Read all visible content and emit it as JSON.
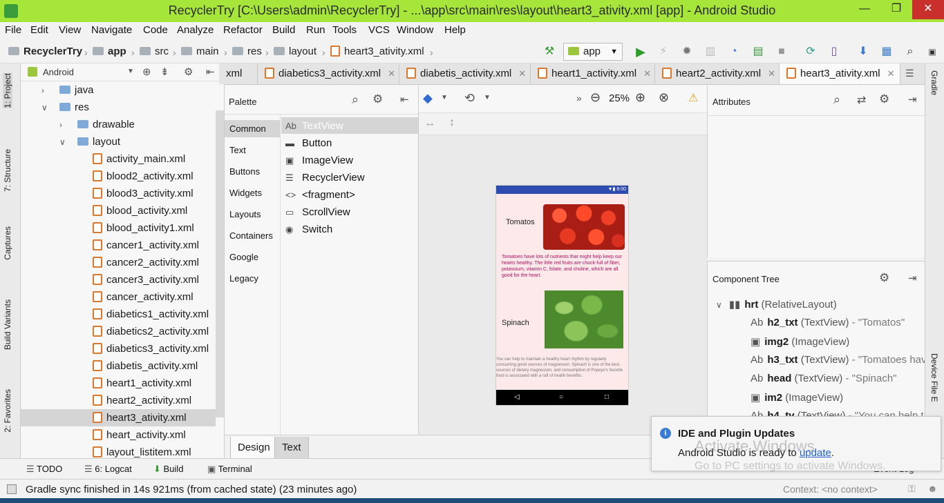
{
  "window": {
    "title": "RecyclerTry [C:\\Users\\admin\\RecyclerTry] - ...\\app\\src\\main\\res\\layout\\heart3_ativity.xml [app] - Android Studio",
    "minimize": "—",
    "maximize": "❐",
    "close": "✕"
  },
  "menu": [
    "File",
    "Edit",
    "View",
    "Navigate",
    "Code",
    "Analyze",
    "Refactor",
    "Build",
    "Run",
    "Tools",
    "VCS",
    "Window",
    "Help"
  ],
  "breadcrumb": [
    "RecyclerTry",
    "app",
    "src",
    "main",
    "res",
    "layout",
    "heart3_ativity.xml"
  ],
  "run_config": "app",
  "project_panel": {
    "view_mode": "Android",
    "tree": [
      {
        "label": "java",
        "kind": "folder",
        "expanded": false
      },
      {
        "label": "res",
        "kind": "folder",
        "expanded": true
      },
      {
        "label": "drawable",
        "kind": "folder",
        "expanded": false
      },
      {
        "label": "layout",
        "kind": "folder",
        "expanded": true
      },
      {
        "label": "activity_main.xml",
        "kind": "xml"
      },
      {
        "label": "blood2_activity.xml",
        "kind": "xml"
      },
      {
        "label": "blood3_activity.xml",
        "kind": "xml"
      },
      {
        "label": "blood_activity.xml",
        "kind": "xml"
      },
      {
        "label": "blood_activity1.xml",
        "kind": "xml"
      },
      {
        "label": "cancer1_activity.xml",
        "kind": "xml"
      },
      {
        "label": "cancer2_activity.xml",
        "kind": "xml"
      },
      {
        "label": "cancer3_activity.xml",
        "kind": "xml"
      },
      {
        "label": "cancer_activity.xml",
        "kind": "xml"
      },
      {
        "label": "diabetics1_activity.xml",
        "kind": "xml"
      },
      {
        "label": "diabetics2_activity.xml",
        "kind": "xml"
      },
      {
        "label": "diabetics3_activity.xml",
        "kind": "xml"
      },
      {
        "label": "diabetis_activity.xml",
        "kind": "xml"
      },
      {
        "label": "heart1_activity.xml",
        "kind": "xml"
      },
      {
        "label": "heart2_activity.xml",
        "kind": "xml"
      },
      {
        "label": "heart3_ativity.xml",
        "kind": "xml",
        "selected": true
      },
      {
        "label": "heart_activity.xml",
        "kind": "xml"
      },
      {
        "label": "layout_listitem.xml",
        "kind": "xml"
      }
    ]
  },
  "left_strip": [
    "1: Project",
    "7: Structure",
    "Captures",
    "Build Variants",
    "2: Favorites"
  ],
  "right_strip": [
    "Gradle",
    "Device File E"
  ],
  "editor_tabs": [
    {
      "label": "xml",
      "active": false
    },
    {
      "label": "diabetics3_activity.xml",
      "active": false
    },
    {
      "label": "diabetis_activity.xml",
      "active": false
    },
    {
      "label": "heart1_activity.xml",
      "active": false
    },
    {
      "label": "heart2_activity.xml",
      "active": false
    },
    {
      "label": "heart3_ativity.xml",
      "active": true
    }
  ],
  "palette": {
    "title": "Palette",
    "categories": [
      "Common",
      "Text",
      "Buttons",
      "Widgets",
      "Layouts",
      "Containers",
      "Google",
      "Legacy"
    ],
    "items": [
      {
        "icon": "Ab",
        "label": "TextView"
      },
      {
        "icon": "▬",
        "label": "Button"
      },
      {
        "icon": "▣",
        "label": "ImageView"
      },
      {
        "icon": "☰",
        "label": "RecyclerView"
      },
      {
        "icon": "<>",
        "label": "<fragment>"
      },
      {
        "icon": "▭",
        "label": "ScrollView"
      },
      {
        "icon": "◉",
        "label": "Switch"
      }
    ]
  },
  "design": {
    "zoom": "25%",
    "phone": {
      "time": "8:00",
      "label1": "Tomatos",
      "text1": "Tomatoes have lots of nutrients that might help keep our hearts healthy. The little red fruits are chock-full of fiber, potassium, vitamin C, folate, and choline, which are all good for the heart.",
      "label2": "Spinach",
      "text2": "You can help to maintain a healthy heart rhythm by regularly consuming good sources of magnesium. Spinach is one of the best sources of dietary magnesium, and consumption of Popeye's favorite food is associated with a raft of health benefits."
    }
  },
  "attributes": {
    "title": "Attributes"
  },
  "component_tree": {
    "title": "Component Tree",
    "root": {
      "id": "hrt",
      "type": "(RelativeLayout)"
    },
    "children": [
      {
        "icon": "Ab",
        "id": "h2_txt",
        "type": "(TextView)",
        "value": "- \"Tomatos\""
      },
      {
        "icon": "img",
        "id": "img2",
        "type": "(ImageView)",
        "value": ""
      },
      {
        "icon": "Ab",
        "id": "h3_txt",
        "type": "(TextView)",
        "value": "- \"Tomatoes hav"
      },
      {
        "icon": "Ab",
        "id": "head",
        "type": "(TextView)",
        "value": "- \"Spinach\""
      },
      {
        "icon": "img",
        "id": "im2",
        "type": "(ImageView)",
        "value": ""
      },
      {
        "icon": "Ab",
        "id": "h4_tv",
        "type": "(TextView)",
        "value": "- \"You can help t"
      }
    ]
  },
  "design_tabs": [
    "Design",
    "Text"
  ],
  "tool_windows": [
    "TODO",
    "6: Logcat",
    "Build",
    "Terminal",
    "Event Log"
  ],
  "status": {
    "message": "Gradle sync finished in 14s 921ms (from cached state) (23 minutes ago)",
    "context": "Context: <no context>"
  },
  "notification": {
    "title": "IDE and Plugin Updates",
    "body": "Android Studio is ready to",
    "link": "update",
    "suffix": ".",
    "watermark1": "Activate Windows",
    "watermark2": "Go to PC settings to activate Windows."
  },
  "colors": {
    "titlebar": "#a6e63a",
    "accent": "#2e4bb0",
    "selection": "#d5d5d5"
  }
}
